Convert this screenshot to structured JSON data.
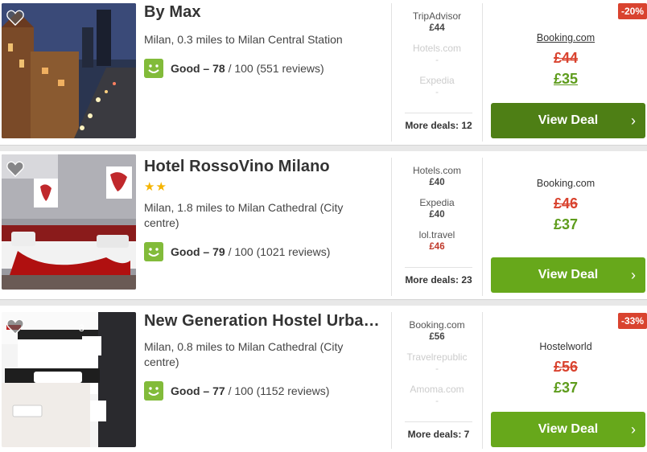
{
  "hotels": [
    {
      "name": "By Max",
      "stars": "",
      "location": "Milan, 0.3 miles to Milan Central Station",
      "rating_label": "Good – 78",
      "rating_rest": " / 100 (551 reviews)",
      "alternatives": [
        {
          "provider": "TripAdvisor",
          "price": "£44",
          "available": true
        },
        {
          "provider": "Hotels.com",
          "price": "-",
          "available": false
        },
        {
          "provider": "Expedia",
          "price": "-",
          "available": false
        }
      ],
      "more_deals": "More deals: 12",
      "badge": "-20%",
      "deal_provider": "Booking.com",
      "old_price": "£44",
      "new_price": "£35",
      "cta": "View Deal"
    },
    {
      "name": "Hotel RossoVino Milano",
      "stars": "★★",
      "location": "Milan, 1.8 miles to Milan Cathedral (City centre)",
      "rating_label": "Good – 79",
      "rating_rest": " / 100 (1021 reviews)",
      "alternatives": [
        {
          "provider": "Hotels.com",
          "price": "£40",
          "available": true
        },
        {
          "provider": "Expedia",
          "price": "£40",
          "available": true
        },
        {
          "provider": "lol.travel",
          "price": "£46",
          "available": true
        }
      ],
      "more_deals": "More deals: 23",
      "badge": "",
      "deal_provider": "Booking.com",
      "old_price": "£46",
      "new_price": "£37",
      "cta": "View Deal"
    },
    {
      "name": "New Generation Hostel Urban...",
      "stars": "",
      "location": "Milan, 0.8 miles to Milan Cathedral (City centre)",
      "rating_label": "Good – 77",
      "rating_rest": " / 100 (1152 reviews)",
      "alternatives": [
        {
          "provider": "Booking.com",
          "price": "£56",
          "available": true
        },
        {
          "provider": "Travelrepublic",
          "price": "-",
          "available": false
        },
        {
          "provider": "Amoma.com",
          "price": "-",
          "available": false
        }
      ],
      "more_deals": "More deals: 7",
      "badge": "-33%",
      "deal_provider": "Hostelworld",
      "old_price": "£56",
      "new_price": "£37",
      "cta": "View Deal"
    }
  ],
  "colors": {
    "accent_green": "#67a81b",
    "accent_green_dark": "#4e7f15",
    "price_red": "#d9432f",
    "rating_green": "#82bb3a"
  },
  "icons": [
    "heart-icon",
    "smiley-icon",
    "chevron-right-icon",
    "star-icon"
  ]
}
